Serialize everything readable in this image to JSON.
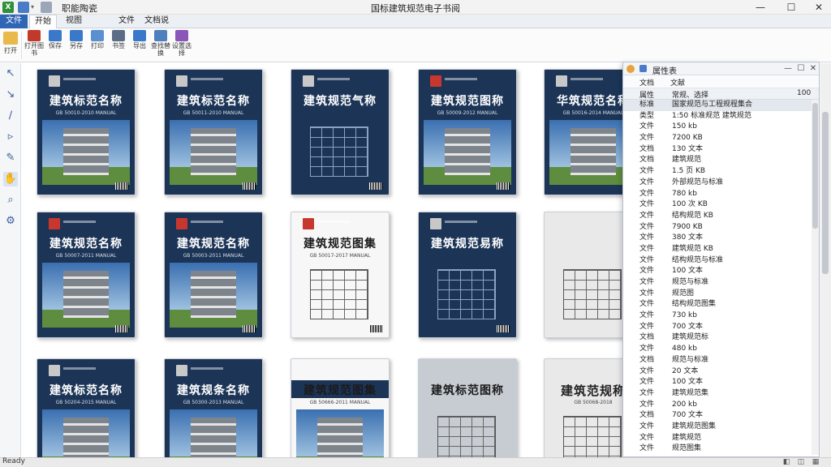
{
  "titlebar": {
    "app_name": "职能陶瓷",
    "window_title": "国标建筑规范电子书阅",
    "min": "—",
    "max": "☐",
    "close": "✕",
    "dropdown": "▾"
  },
  "tabs": [
    "文件",
    "开始",
    "视图",
    "文件",
    "文档说明"
  ],
  "ribbon": {
    "open_label": "打开",
    "buttons": [
      {
        "label": "打开图书",
        "color": "#c0392b"
      },
      {
        "label": "保存",
        "color": "#3a78c9"
      },
      {
        "label": "另存",
        "color": "#3a78c9"
      },
      {
        "label": "打印",
        "color": "#5a8fd0"
      },
      {
        "label": "书签",
        "color": "#5b6d86"
      },
      {
        "label": "导出",
        "color": "#3a78c9"
      },
      {
        "label": "查找替换",
        "color": "#4e7fbf"
      },
      {
        "label": "设置选择",
        "color": "#8c55b8"
      }
    ]
  },
  "left_tools": [
    {
      "icon": "↖",
      "name": "select-arrow-icon"
    },
    {
      "icon": "↘",
      "name": "pointer-icon"
    },
    {
      "icon": "∕",
      "name": "line-icon"
    },
    {
      "icon": "▹",
      "name": "flag-icon"
    },
    {
      "icon": "✎",
      "name": "pen-icon"
    },
    {
      "icon": "✋",
      "name": "hand-icon"
    },
    {
      "icon": "⌕",
      "name": "zoom-icon"
    },
    {
      "icon": "⚙",
      "name": "gear-icon"
    }
  ],
  "books": [
    {
      "title": "建筑标范名称",
      "sub": "GB 50010-2010 MANUAL",
      "style": "navy",
      "logo": "gray",
      "art": "photo"
    },
    {
      "title": "建筑标范名称",
      "sub": "GB 50011-2010 MANUAL",
      "style": "navy",
      "logo": "gray",
      "art": "photo"
    },
    {
      "title": "建筑规范气称",
      "sub": "",
      "style": "navy",
      "logo": "gray",
      "art": "wire"
    },
    {
      "title": "建筑规范图称",
      "sub": "GB 50009-2012 MANUAL",
      "style": "navy",
      "logo": "red",
      "art": "photo"
    },
    {
      "title": "华筑规范名称",
      "sub": "GB 50016-2014 MANUAL",
      "style": "navy",
      "logo": "gray",
      "art": "photo"
    },
    {
      "title": "建筑规范名称",
      "sub": "GB 50007-2011 MANUAL",
      "style": "navy",
      "logo": "red",
      "art": "photo"
    },
    {
      "title": "建筑规范名称",
      "sub": "GB 50003-2011 MANUAL",
      "style": "navy",
      "logo": "red",
      "art": "photo"
    },
    {
      "title": "建筑规范图集",
      "sub": "GB 50017-2017 MANUAL",
      "style": "white",
      "logo": "red",
      "art": "wire-dark"
    },
    {
      "title": "建筑规范易称",
      "sub": "",
      "style": "navy",
      "logo": "gray",
      "art": "wire"
    },
    {
      "title": "",
      "sub": "",
      "style": "sketch",
      "logo": "none",
      "art": "wire-dark"
    },
    {
      "title": "建筑标范名称",
      "sub": "GB 50204-2015 MANUAL",
      "style": "navy",
      "logo": "gray",
      "art": "photo"
    },
    {
      "title": "建筑规条名称",
      "sub": "GB 50300-2013 MANUAL",
      "style": "navy",
      "logo": "gray",
      "art": "photo"
    },
    {
      "title": "建筑规范图集",
      "sub": "GB 50666-2011 MANUAL",
      "style": "white",
      "logo": "none",
      "art": "photo"
    },
    {
      "title": "建筑标范图称",
      "sub": "",
      "style": "gray",
      "logo": "none",
      "art": "wire-dark"
    },
    {
      "title": "建筑范规称",
      "sub": "GB 50068-2018",
      "style": "sketch",
      "logo": "none",
      "art": "wire-dark"
    }
  ],
  "panel": {
    "title": "属性表",
    "tabs": [
      "文档",
      "文献"
    ],
    "header": {
      "c1": "属性",
      "c2": "常规、选择",
      "c3": "100"
    },
    "rows": [
      {
        "k": "标准",
        "v": "国家规范与工程规程集合",
        "hl": true
      },
      {
        "k": "类型",
        "v": "1:50 标准规范 建筑规范"
      },
      {
        "k": "文件",
        "v": "150 kb"
      },
      {
        "k": "文件",
        "v": "7200 KB"
      },
      {
        "k": "文档",
        "v": "130 文本"
      },
      {
        "k": "文档",
        "v": "建筑规范"
      },
      {
        "k": "文件",
        "v": "1.5 页 KB"
      },
      {
        "k": "文件",
        "v": "外部规范与标准"
      },
      {
        "k": "文件",
        "v": "780 kb"
      },
      {
        "k": "文件",
        "v": "100 次 KB"
      },
      {
        "k": "文件",
        "v": "结构规范 KB"
      },
      {
        "k": "文件",
        "v": "7900 KB"
      },
      {
        "k": "文件",
        "v": "380 文本"
      },
      {
        "k": "文件",
        "v": "建筑规范 KB"
      },
      {
        "k": "文件",
        "v": "结构规范与标准"
      },
      {
        "k": "文件",
        "v": "100 文本"
      },
      {
        "k": "文件",
        "v": "规范与标准"
      },
      {
        "k": "文件",
        "v": "规范图"
      },
      {
        "k": "文件",
        "v": "结构规范图集"
      },
      {
        "k": "文件",
        "v": "730 kb"
      },
      {
        "k": "文件",
        "v": "700 文本"
      },
      {
        "k": "文档",
        "v": "建筑规范标"
      },
      {
        "k": "文件",
        "v": "480 kb"
      },
      {
        "k": "文档",
        "v": "规范与标准"
      },
      {
        "k": "文件",
        "v": "20 文本"
      },
      {
        "k": "文件",
        "v": "100 文本"
      },
      {
        "k": "文件",
        "v": "建筑规范集"
      },
      {
        "k": "文件",
        "v": "200 kb"
      },
      {
        "k": "文档",
        "v": "700 文本"
      },
      {
        "k": "文件",
        "v": "建筑规范图集"
      },
      {
        "k": "文件",
        "v": "建筑规范"
      },
      {
        "k": "文件",
        "v": "规范图集"
      }
    ]
  },
  "status": {
    "text": "Ready",
    "icons": [
      "◧",
      "◫",
      "▦"
    ]
  }
}
